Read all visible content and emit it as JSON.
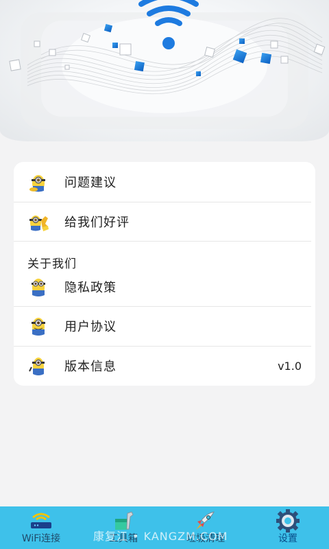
{
  "menu": {
    "items_top": [
      {
        "label": "问题建议",
        "icon": "minion-icon"
      },
      {
        "label": "给我们好评",
        "icon": "minion-thumbs-icon"
      }
    ],
    "section_title": "关于我们",
    "items_about": [
      {
        "label": "隐私政策",
        "icon": "minion-icon"
      },
      {
        "label": "用户协议",
        "icon": "minion-icon"
      },
      {
        "label": "版本信息",
        "icon": "minion-icon",
        "value": "v1.0"
      }
    ]
  },
  "nav": {
    "tabs": [
      {
        "label": "WiFi连接",
        "icon": "wifi-router-icon"
      },
      {
        "label": "工具箱",
        "icon": "toolbox-icon"
      },
      {
        "label": "垃圾清理",
        "icon": "rocket-icon"
      },
      {
        "label": "设置",
        "icon": "gear-icon",
        "active": true
      }
    ]
  },
  "watermark": "康复江 • KANGZM.COM",
  "colors": {
    "nav_bg": "#3ec1ea",
    "accent_blue": "#1e7be0"
  }
}
